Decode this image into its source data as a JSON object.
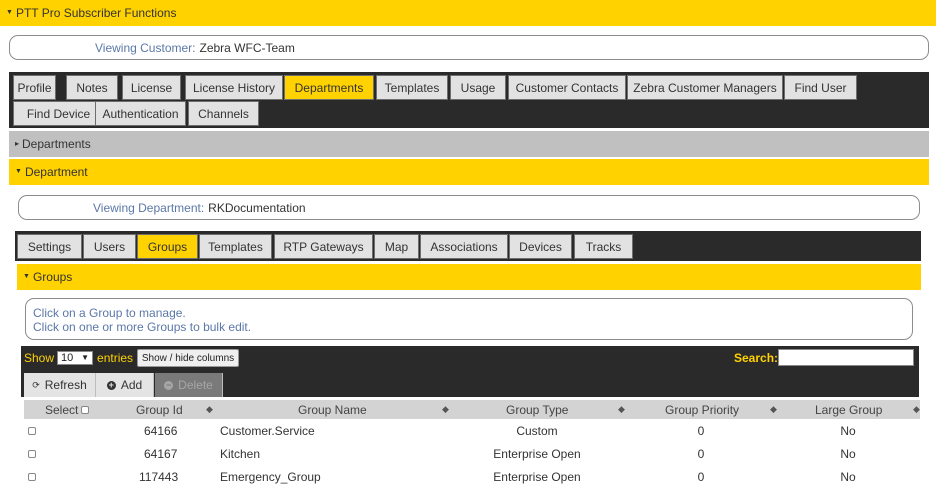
{
  "top_section": {
    "title": "PTT Pro Subscriber Functions"
  },
  "customer_box": {
    "label": "Viewing Customer:",
    "value": "Zebra WFC-Team"
  },
  "customer_tabs": [
    {
      "label": "Profile"
    },
    {
      "label": "Notes"
    },
    {
      "label": "License"
    },
    {
      "label": "License History"
    },
    {
      "label": "Departments"
    },
    {
      "label": "Templates"
    },
    {
      "label": "Usage"
    },
    {
      "label": "Customer Contacts"
    },
    {
      "label": "Zebra Customer Managers"
    },
    {
      "label": "Find User"
    },
    {
      "label": "Find Device"
    },
    {
      "label": "Authentication"
    },
    {
      "label": "Channels"
    }
  ],
  "customer_active_tab": "Departments",
  "departments_section": {
    "title": "Departments"
  },
  "department_section": {
    "title": "Department"
  },
  "department_box": {
    "label": "Viewing Department:",
    "value": "RKDocumentation"
  },
  "department_tabs": [
    {
      "label": "Settings"
    },
    {
      "label": "Users"
    },
    {
      "label": "Groups"
    },
    {
      "label": "Templates"
    },
    {
      "label": "RTP Gateways"
    },
    {
      "label": "Map"
    },
    {
      "label": "Associations"
    },
    {
      "label": "Devices"
    },
    {
      "label": "Tracks"
    }
  ],
  "department_active_tab": "Groups",
  "groups_section": {
    "title": "Groups"
  },
  "help_box": {
    "line1": "Click on a Group to manage.",
    "line2": "Click on one or more Groups to bulk edit."
  },
  "table_controls": {
    "show_label": "Show",
    "entries_value": "10",
    "entries_label": "entries",
    "show_hide_label": "Show / hide columns",
    "search_label": "Search:",
    "search_value": ""
  },
  "actions": {
    "refresh": "Refresh",
    "add": "Add",
    "delete": "Delete"
  },
  "columns": [
    "Select",
    "Group Id",
    "Group Name",
    "Group Type",
    "Group Priority",
    "Large Group"
  ],
  "rows": [
    {
      "id": "64166",
      "name": "Customer.Service",
      "type": "Custom",
      "priority": "0",
      "large": "No"
    },
    {
      "id": "64167",
      "name": "Kitchen",
      "type": "Enterprise Open",
      "priority": "0",
      "large": "No"
    },
    {
      "id": "117443",
      "name": "Emergency_Group",
      "type": "Enterprise Open",
      "priority": "0",
      "large": "No"
    }
  ],
  "colors": {
    "accent": "#ffd200",
    "dark": "#2a2a2a",
    "link_blue": "#5b78a8",
    "section_gray": "#c0c0c0"
  }
}
